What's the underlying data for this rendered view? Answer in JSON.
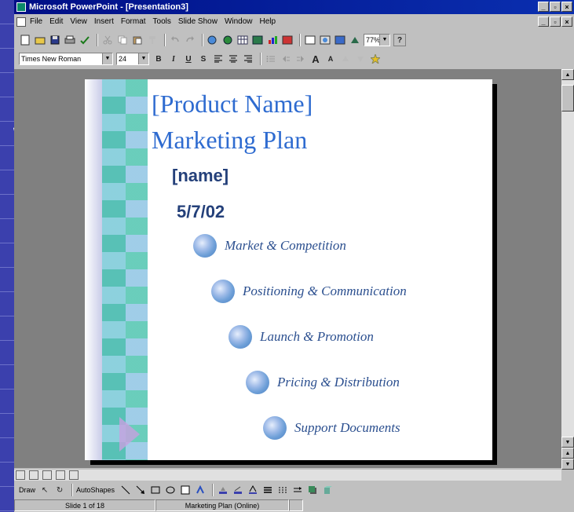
{
  "app": {
    "title": "Microsoft PowerPoint - [Presentation3]",
    "window_controls": [
      "_",
      "▫",
      "×"
    ],
    "doc_controls": [
      "_",
      "▫",
      "×"
    ]
  },
  "menubar": {
    "items": [
      "File",
      "Edit",
      "View",
      "Insert",
      "Format",
      "Tools",
      "Slide Show",
      "Window",
      "Help"
    ]
  },
  "toolbar1": {
    "zoom": "77%",
    "help_glyph": "?"
  },
  "toolbar2": {
    "font": "Times New Roman",
    "size": "24",
    "bold": "B",
    "italic": "I",
    "underline": "U",
    "shadow": "S",
    "grow_font": "A",
    "shrink_font": "A"
  },
  "slide": {
    "title": "[Product Name]",
    "subtitle": "Marketing Plan",
    "name": "[name]",
    "date": "5/7/02",
    "bullets": [
      "Market & Competition",
      "Positioning & Communication",
      "Launch & Promotion",
      "Pricing & Distribution",
      "Support Documents"
    ]
  },
  "drawbar": {
    "draw": "Draw",
    "autoshapes": "AutoShapes"
  },
  "statusbar": {
    "slide": "Slide 1 of 18",
    "template": "Marketing Plan (Online)"
  },
  "colors": {
    "title_blue": "#2e6bd0",
    "text_navy": "#24407a",
    "titlebar": "#000f86"
  }
}
